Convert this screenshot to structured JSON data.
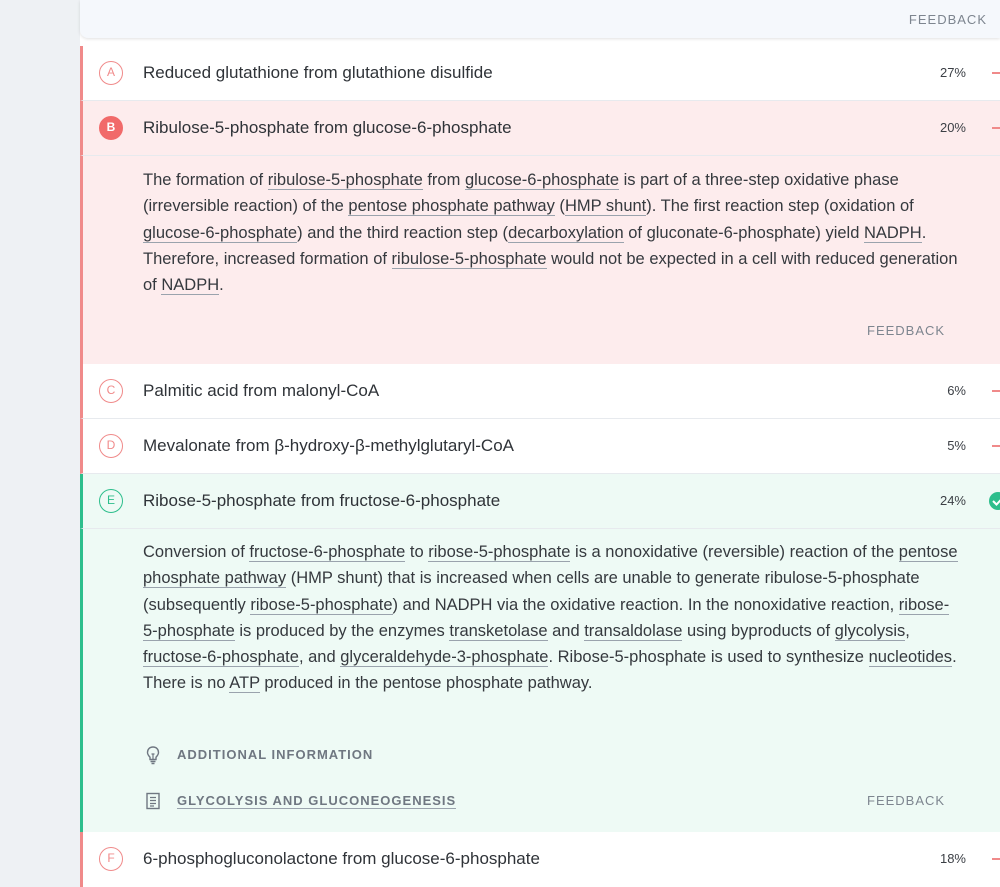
{
  "header": {
    "feedback_label": "FEEDBACK"
  },
  "answers": [
    {
      "letter": "A",
      "text": "Reduced glutathione from glutathione disulfide",
      "percent": "27%"
    },
    {
      "letter": "B",
      "text": "Ribulose-5-phosphate from glucose-6-phosphate",
      "percent": "20%"
    },
    {
      "letter": "C",
      "text": "Palmitic acid from malonyl-CoA",
      "percent": "6%"
    },
    {
      "letter": "D",
      "text": "Mevalonate from β-hydroxy-β-methylglutaryl-CoA",
      "percent": "5%"
    },
    {
      "letter": "E",
      "text": "Ribose-5-phosphate from fructose-6-phosphate",
      "percent": "24%"
    },
    {
      "letter": "F",
      "text": "6-phosphogluconolactone from glucose-6-phosphate",
      "percent": "18%"
    }
  ],
  "explanation_b": {
    "segments": [
      "The formation of ",
      "ribulose-5-phosphate",
      " from ",
      "glucose-6-phosphate",
      " is part of a three-step oxidative phase (irreversible reaction) of the ",
      "pentose phosphate pathway",
      " (",
      "HMP shunt",
      "). The first reaction step (oxidation of ",
      "glucose-6-phosphate",
      ") and the third reaction step (",
      "decarboxylation",
      " of gluconate-6-phosphate) yield ",
      "NADPH",
      ". Therefore, increased formation of ",
      "ribulose-5-phosphate",
      " would not be expected in a cell with reduced generation of ",
      "NADPH",
      "."
    ],
    "feedback_label": "FEEDBACK"
  },
  "explanation_e": {
    "segments": [
      "Conversion of ",
      "fructose-6-phosphate",
      " to ",
      "ribose-5-phosphate",
      " is a nonoxidative (reversible) reaction of the ",
      "pentose phosphate pathway",
      " (HMP shunt) that is increased when cells are unable to generate ribulose-5-phosphate (subsequently ",
      "ribose-5-phosphate",
      ") and NADPH via the oxidative reaction. In the nonoxidative reaction, ",
      "ribose-5-phosphate",
      " is produced by the enzymes ",
      "transketolase",
      " and ",
      "transaldolase",
      " using byproducts of ",
      "glycolysis",
      ", ",
      "fructose-6-phosphate",
      ", and ",
      "glyceraldehyde-3-phosphate",
      ". Ribose-5-phosphate is used to synthesize ",
      "nucleotides",
      ". There is no ",
      "ATP",
      " produced in the pentose phosphate pathway."
    ],
    "additional_info_label": "ADDITIONAL INFORMATION",
    "article_link_label": "GLYCOLYSIS AND GLUCONEOGENESIS",
    "feedback_label": "FEEDBACK"
  },
  "icons": {
    "additional_info": "lightbulb-icon",
    "article": "document-icon",
    "correct": "check-circle-icon"
  },
  "colors": {
    "wrong": "#f08a8a",
    "correct": "#2dbe8c",
    "wrong_bg": "#fdeced",
    "correct_bg": "#eefaf5"
  }
}
